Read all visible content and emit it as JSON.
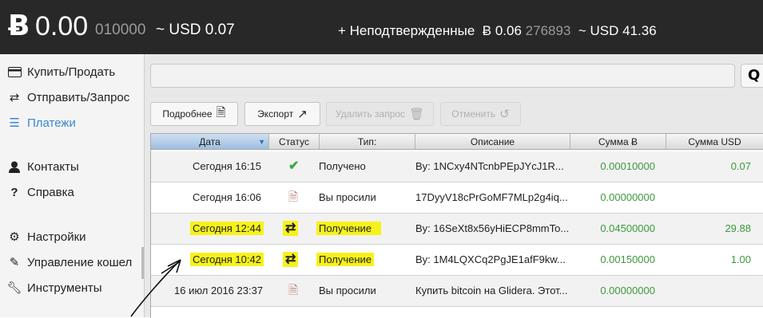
{
  "header": {
    "btc_symbol": "Ƀ",
    "balance_main": "0.00",
    "balance_sub": "010000",
    "balance_usd": "~ USD 0.07",
    "unconfirmed_label": "+ Неподтвержденные",
    "unconfirmed_btc_main": "Ƀ 0.06",
    "unconfirmed_btc_sub": "276893",
    "unconfirmed_usd": "~ USD 41.36"
  },
  "sidebar": {
    "items": [
      {
        "label": "Купить/Продать",
        "icon": "credit-card-icon"
      },
      {
        "label": "Отправить/Запрос",
        "icon": "exchange-icon"
      },
      {
        "label": "Платежи",
        "icon": "list-icon"
      },
      {
        "label": "Контакты",
        "icon": "user-icon"
      },
      {
        "label": "Справка",
        "icon": "question-icon"
      },
      {
        "label": "Настройки",
        "icon": "gears-icon"
      },
      {
        "label": "Управление кошел",
        "icon": "edit-icon"
      },
      {
        "label": "Инструменты",
        "icon": "wrench-icon"
      }
    ],
    "active_index": 2
  },
  "toolbar": {
    "details_label": "Подробнее",
    "export_label": "Экспорт",
    "delete_request_label": "Удалить запрос",
    "cancel_label": "Отменить"
  },
  "table": {
    "headers": [
      "Дата",
      "Статус",
      "Тип:",
      "Описание",
      "Сумма Ƀ",
      "Сумма USD"
    ],
    "rows": [
      {
        "date": "Сегодня 16:15",
        "status": "check-icon",
        "type": "Получено",
        "description": "By: 1NCxy4NTcnbPEpJYcJ1R...",
        "amount_btc": "0.00010000",
        "amount_usd": "0.07",
        "highlight": false
      },
      {
        "date": "Сегодня 16:06",
        "status": "document-icon",
        "type": "Вы просили",
        "description": "17DyyV18cPrGoMF7MLp2g4iq...",
        "amount_btc": "0.00000000",
        "amount_usd": "",
        "highlight": false
      },
      {
        "date": "Сегодня 12:44",
        "status": "exchange-icon",
        "type": "Получение",
        "description": "By: 16SeXt8x56yHiECP8mmTo...",
        "amount_btc": "0.04500000",
        "amount_usd": "29.88",
        "highlight": true
      },
      {
        "date": "Сегодня 10:42",
        "status": "exchange-icon",
        "type": "Получение",
        "description": "By: 1M4LQXCq2PgJE1afF9kw...",
        "amount_btc": "0.00150000",
        "amount_usd": "1.00",
        "highlight": true
      },
      {
        "date": "16 июл 2016 23:37",
        "status": "document-icon",
        "type": "Вы просили",
        "description": "Купить bitcoin на Glidera. Этот...",
        "amount_btc": "0.00000000",
        "amount_usd": "",
        "highlight": false
      }
    ]
  },
  "colors": {
    "topbar": "#282828",
    "active_nav": "#3a87ce",
    "amount_green": "#3c9a3c",
    "highlight": "#f6f21c"
  }
}
